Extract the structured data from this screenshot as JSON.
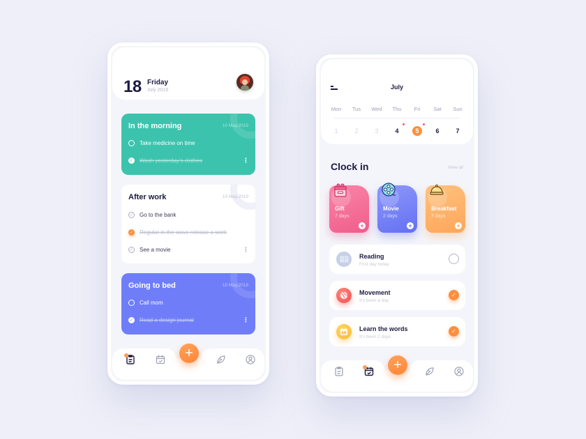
{
  "phone1": {
    "header": {
      "day_number": "18",
      "day_name": "Friday",
      "month_year": "July 2019"
    },
    "task_groups": [
      {
        "title": "In the morning",
        "date": "10 May,2019",
        "theme": "green",
        "items": [
          {
            "label": "Take medicine on time",
            "done": false
          },
          {
            "label": "Wash yesterday's clothes",
            "done": true
          }
        ]
      },
      {
        "title": "After work",
        "date": "10 May,2019",
        "theme": "white",
        "items": [
          {
            "label": "Go to the bank",
            "done": false
          },
          {
            "label": "Regular in the wave release a work",
            "done": true
          },
          {
            "label": "See a movie",
            "done": false
          }
        ]
      },
      {
        "title": "Going to bed",
        "date": "10 May,2019",
        "theme": "blue",
        "items": [
          {
            "label": "Call mom",
            "done": false
          },
          {
            "label": "Read a design journal",
            "done": true
          }
        ]
      }
    ],
    "nav": {
      "active": "tasks",
      "fab_label": "+"
    }
  },
  "phone2": {
    "calendar": {
      "month": "July",
      "weekdays": [
        "Mon",
        "Tus",
        "Wed",
        "Thu",
        "Fri",
        "Sat",
        "Sun"
      ],
      "days": [
        "1",
        "2",
        "3",
        "4",
        "5",
        "6",
        "7"
      ],
      "selected_day": "5",
      "event_days": [
        "4",
        "5"
      ]
    },
    "clock_in": {
      "title": "Clock in",
      "view_all": "View all",
      "cards": [
        {
          "name": "Gift",
          "days": "7 days",
          "icon": "gift-box-icon"
        },
        {
          "name": "Movie",
          "days": "2 days",
          "icon": "film-reel-icon"
        },
        {
          "name": "Breakfast",
          "days": "7 days",
          "icon": "food-cloche-icon"
        }
      ],
      "habits": [
        {
          "name": "Reading",
          "sub": "First day today",
          "done": false,
          "icon": "book-icon"
        },
        {
          "name": "Movement",
          "sub": "It's been a day",
          "done": true,
          "icon": "ball-icon"
        },
        {
          "name": "Learn the words",
          "sub": "It's been 2 days",
          "done": true,
          "icon": "ab-calendar-icon"
        }
      ]
    },
    "nav": {
      "active": "calendar",
      "fab_label": "+"
    }
  },
  "colors": {
    "background": "#eeeff8",
    "accent_orange": "#ff8e3c",
    "green": "#3cc3ad",
    "blue": "#6f7ef8",
    "pink": "#ef5d8b",
    "yellow": "#fda65a",
    "text_dark": "#1c1b40"
  }
}
